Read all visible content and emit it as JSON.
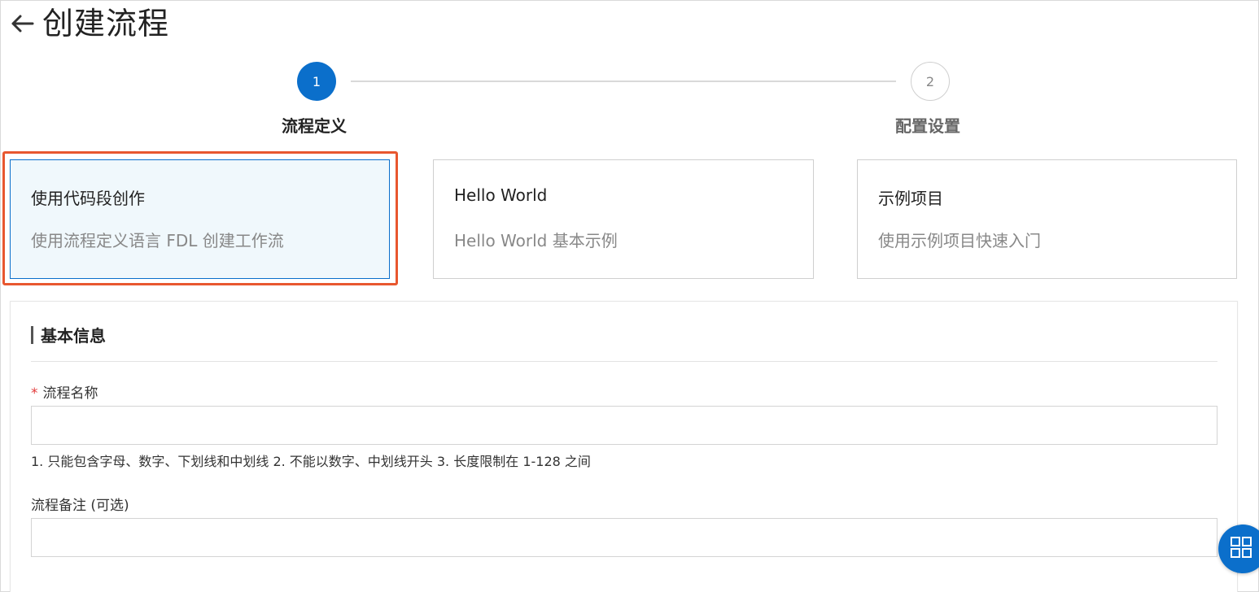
{
  "header": {
    "back_icon": "arrow-left-icon",
    "title": "创建流程"
  },
  "steps": [
    {
      "number": "1",
      "label": "流程定义",
      "state": "active"
    },
    {
      "number": "2",
      "label": "配置设置",
      "state": "pending"
    }
  ],
  "templates": [
    {
      "title": "使用代码段创作",
      "description": "使用流程定义语言 FDL 创建工作流",
      "selected": true
    },
    {
      "title": "Hello World",
      "description": "Hello World 基本示例",
      "selected": false
    },
    {
      "title": "示例项目",
      "description": "使用示例项目快速入门",
      "selected": false
    }
  ],
  "form": {
    "section_title": "基本信息",
    "name": {
      "required_mark": "*",
      "label": "流程名称",
      "value": "",
      "hint": "1. 只能包含字母、数字、下划线和中划线 2. 不能以数字、中划线开头 3. 长度限制在 1-128 之间"
    },
    "note": {
      "label": "流程备注 (可选)",
      "value": ""
    }
  },
  "fab": {
    "icon": "grid-apps-icon"
  },
  "colors": {
    "primary": "#0b6fcb",
    "highlight": "#e8572f",
    "required": "#e23b3b",
    "selected_card_bg": "#f0f8fc"
  }
}
